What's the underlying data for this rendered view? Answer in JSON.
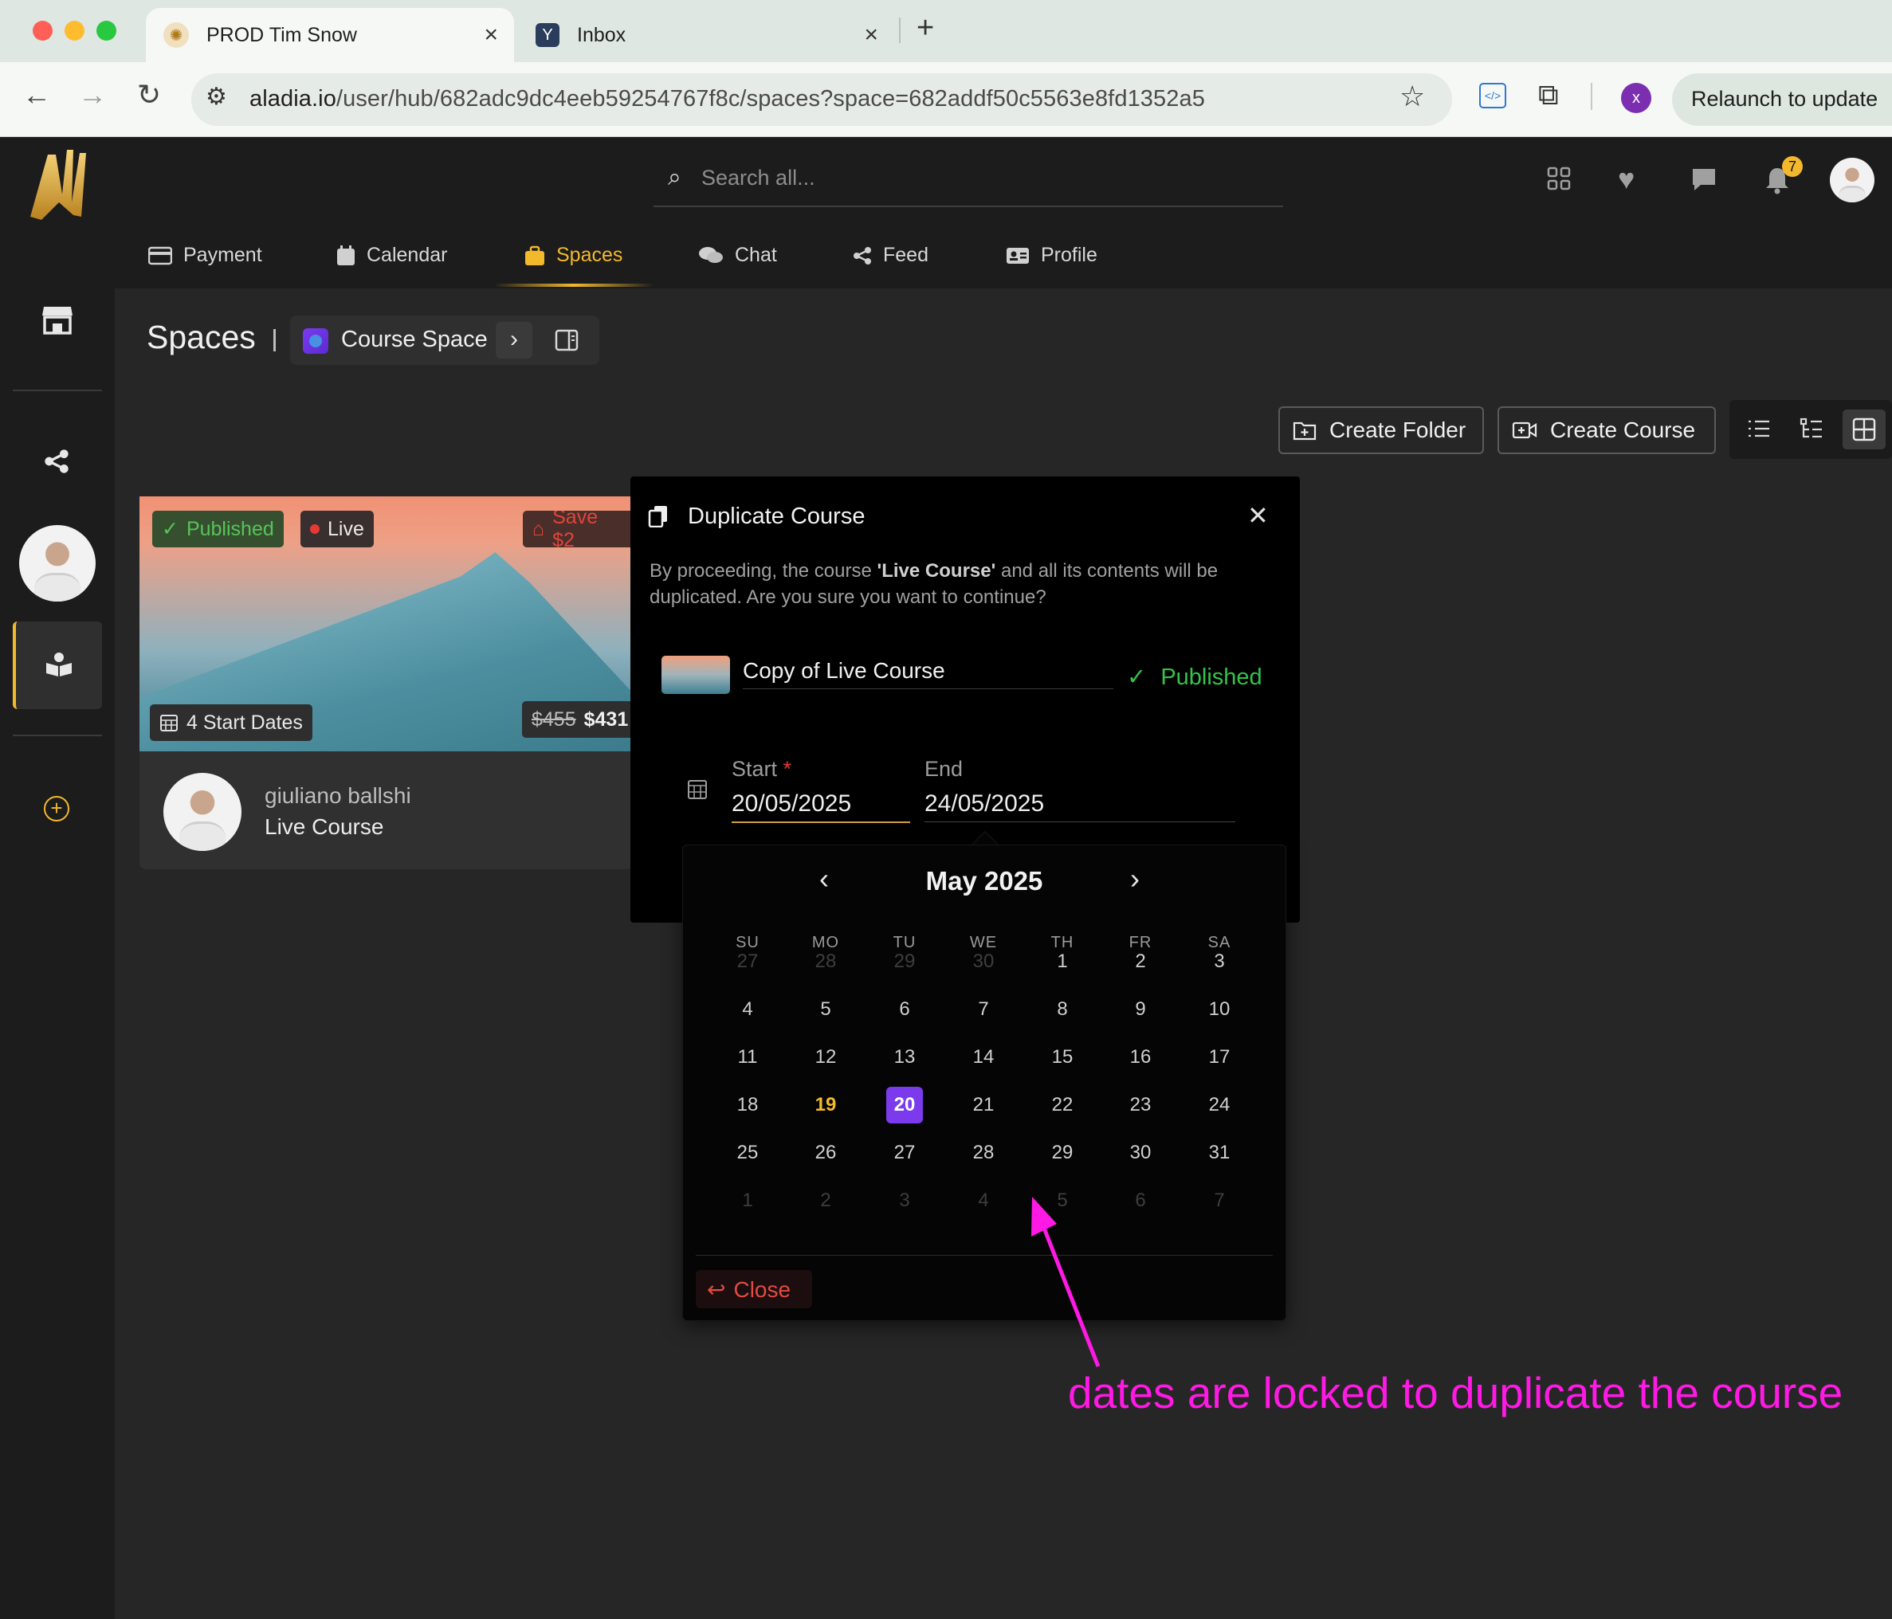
{
  "browser": {
    "tabs": [
      {
        "title": "PROD Tim Snow",
        "active": true
      },
      {
        "title": "Inbox",
        "active": false
      }
    ],
    "url_host": "aladia.io",
    "url_path": "/user/hub/682adc9dc4eeb59254767f8c/spaces?space=682addf50c5563e8fd1352a5",
    "profile_initial": "x",
    "relaunch_label": "Relaunch to update"
  },
  "header": {
    "search_placeholder": "Search all...",
    "notification_count": "7",
    "nav": [
      {
        "label": "Payment",
        "icon": "credit-card-icon"
      },
      {
        "label": "Calendar",
        "icon": "calendar-icon"
      },
      {
        "label": "Spaces",
        "icon": "briefcase-icon",
        "active": true
      },
      {
        "label": "Chat",
        "icon": "chat-icon"
      },
      {
        "label": "Feed",
        "icon": "share-icon"
      },
      {
        "label": "Profile",
        "icon": "id-card-icon"
      }
    ]
  },
  "breadcrumb": {
    "title": "Spaces",
    "space_name": "Course Space"
  },
  "actions": {
    "create_folder": "Create Folder",
    "create_course": "Create Course"
  },
  "course_card": {
    "published_badge": "Published",
    "live_badge": "Live",
    "save_badge": "Save $2",
    "start_dates": "4 Start Dates",
    "old_price": "$455",
    "new_price": "$431",
    "author": "giuliano ballshi",
    "course_name": "Live Course"
  },
  "modal": {
    "title": "Duplicate Course",
    "message_prefix": "By proceeding, the course ",
    "message_course": "'Live Course'",
    "message_suffix": " and all its contents will be duplicated. Are you sure you want to continue?",
    "copy_name": "Copy of Live Course",
    "status": "Published",
    "start_label": "Start",
    "start_required": "*",
    "start_value": "20/05/2025",
    "end_label": "End",
    "end_value": "24/05/2025"
  },
  "datepicker": {
    "month_label": "May 2025",
    "weekdays": [
      "SU",
      "MO",
      "TU",
      "WE",
      "TH",
      "FR",
      "SA"
    ],
    "weeks": [
      [
        "27",
        "28",
        "29",
        "30",
        "1",
        "2",
        "3"
      ],
      [
        "4",
        "5",
        "6",
        "7",
        "8",
        "9",
        "10"
      ],
      [
        "11",
        "12",
        "13",
        "14",
        "15",
        "16",
        "17"
      ],
      [
        "18",
        "19",
        "20",
        "21",
        "22",
        "23",
        "24"
      ],
      [
        "25",
        "26",
        "27",
        "28",
        "29",
        "30",
        "31"
      ],
      [
        "1",
        "2",
        "3",
        "4",
        "5",
        "6",
        "7"
      ]
    ],
    "today": "19",
    "selected": "20",
    "close_label": "Close"
  },
  "annotation": {
    "text": "dates are locked to duplicate the course",
    "color": "#ff19e4"
  },
  "colors": {
    "accent": "#f3b92d",
    "selected_day": "#7c3aed",
    "published_green": "#34c34a"
  }
}
